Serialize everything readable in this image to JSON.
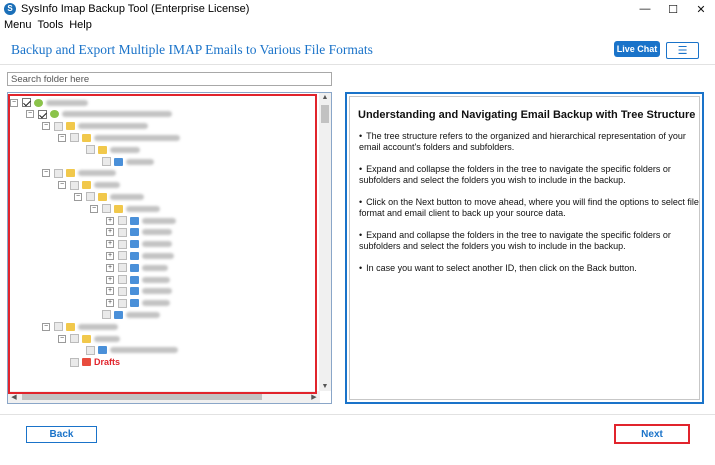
{
  "window": {
    "title": "SysInfo Imap Backup Tool (Enterprise License)",
    "minimize": "—",
    "maximize": "☐",
    "close": "✕"
  },
  "menu": [
    "Menu",
    "Tools",
    "Help"
  ],
  "header": {
    "title": "Backup and Export Multiple IMAP Emails to Various File Formats",
    "live_chat": "Live Chat",
    "menu_icon": "☰"
  },
  "search": {
    "placeholder": "Search folder here",
    "value": ""
  },
  "tree": {
    "visible_label": "Drafts"
  },
  "info": {
    "title": "Understanding and Navigating Email Backup with Tree Structure",
    "items": [
      "The tree structure refers to the organized and hierarchical representation of your email account's folders and subfolders.",
      "Expand and collapse the folders in the tree to navigate the specific folders or subfolders and select the folders you wish to include in the backup.",
      "Click on the Next button to move ahead, where you will find the options to select file format and email client to back up your source data.",
      "Expand and collapse the folders in the tree to navigate the specific folders or subfolders and select the folders you wish to include in the backup.",
      "In case you want to select another ID, then click on the Back button."
    ]
  },
  "buttons": {
    "back": "Back",
    "next": "Next"
  },
  "colors": {
    "accent": "#1a73c9",
    "highlight": "#e1242c"
  }
}
